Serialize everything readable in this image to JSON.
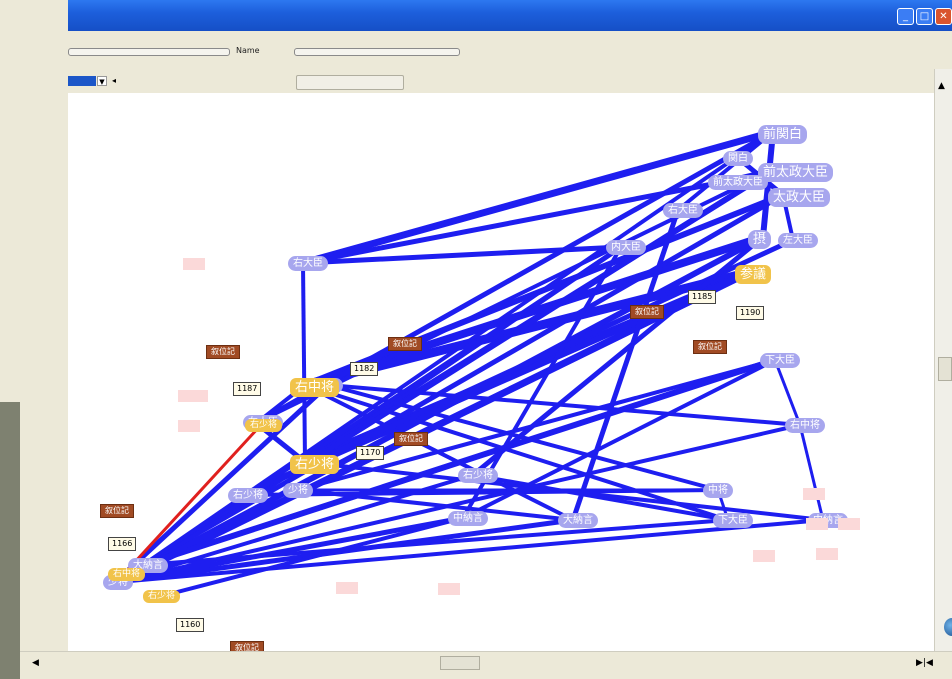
{
  "window": {
    "name_label": "Name"
  },
  "titlebar_buttons": {
    "minimize": "_",
    "maximize": "□",
    "close": "✕"
  },
  "scroll_arrows": {
    "up": "▲",
    "left": "◀",
    "right": "▶|◀",
    "bg_arrows": "▸|◂"
  },
  "colors": {
    "edge_blue": "#1e1ef0",
    "edge_red": "#e0201e",
    "node_purple": "#a7a6ee",
    "node_yellow": "#f1c34a",
    "node_brown": "#a14b24",
    "titlebar": "#1d5fdc"
  },
  "graph": {
    "nodes_purple": [
      "前関白",
      "関白",
      "前太政大臣",
      "太政大臣",
      "前左大臣",
      "内大臣",
      "摂",
      "右大臣",
      "左大臣",
      "下大臣",
      "右中将",
      "中将",
      "右少将",
      "少将",
      "大納言",
      "中納言"
    ],
    "nodes_yellow": [
      "参議",
      "右中将",
      "右少将"
    ],
    "nodes_brown": [
      "叙位記"
    ],
    "years": [
      "1185",
      "1190",
      "1182",
      "1187",
      "1170",
      "1166",
      "1160"
    ]
  }
}
